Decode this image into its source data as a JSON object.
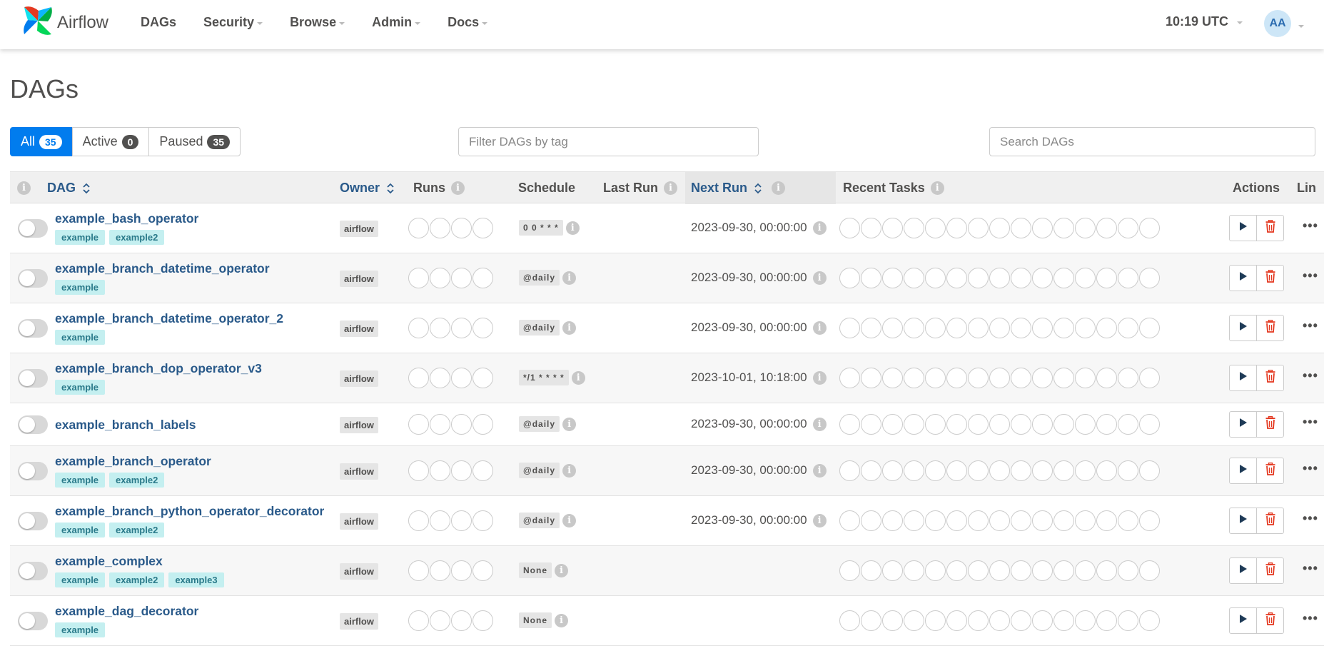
{
  "nav": {
    "brand": "Airflow",
    "items": [
      "DAGs",
      "Security",
      "Browse",
      "Admin",
      "Docs"
    ],
    "clock": "10:19 UTC",
    "user_initials": "AA"
  },
  "page": {
    "title": "DAGs"
  },
  "filters": {
    "all_label": "All",
    "all_count": "35",
    "active_label": "Active",
    "active_count": "0",
    "paused_label": "Paused",
    "paused_count": "35",
    "tag_placeholder": "Filter DAGs by tag",
    "search_placeholder": "Search DAGs"
  },
  "table": {
    "headers": {
      "dag": "DAG",
      "owner": "Owner",
      "runs": "Runs",
      "schedule": "Schedule",
      "last_run": "Last Run",
      "next_run": "Next Run",
      "recent_tasks": "Recent Tasks",
      "actions": "Actions",
      "links": "Lin"
    },
    "rows": [
      {
        "name": "example_bash_operator",
        "tags": [
          "example",
          "example2"
        ],
        "owner": "airflow",
        "schedule": "0 0 * * *",
        "next_run": "2023-09-30, 00:00:00",
        "paused": true
      },
      {
        "name": "example_branch_datetime_operator",
        "tags": [
          "example"
        ],
        "owner": "airflow",
        "schedule": "@daily",
        "next_run": "2023-09-30, 00:00:00",
        "paused": true
      },
      {
        "name": "example_branch_datetime_operator_2",
        "tags": [
          "example"
        ],
        "owner": "airflow",
        "schedule": "@daily",
        "next_run": "2023-09-30, 00:00:00",
        "paused": true
      },
      {
        "name": "example_branch_dop_operator_v3",
        "tags": [
          "example"
        ],
        "owner": "airflow",
        "schedule": "*/1 * * * *",
        "next_run": "2023-10-01, 10:18:00",
        "paused": true
      },
      {
        "name": "example_branch_labels",
        "tags": [],
        "owner": "airflow",
        "schedule": "@daily",
        "next_run": "2023-09-30, 00:00:00",
        "paused": true
      },
      {
        "name": "example_branch_operator",
        "tags": [
          "example",
          "example2"
        ],
        "owner": "airflow",
        "schedule": "@daily",
        "next_run": "2023-09-30, 00:00:00",
        "paused": true
      },
      {
        "name": "example_branch_python_operator_decorator",
        "tags": [
          "example",
          "example2"
        ],
        "owner": "airflow",
        "schedule": "@daily",
        "next_run": "2023-09-30, 00:00:00",
        "paused": true
      },
      {
        "name": "example_complex",
        "tags": [
          "example",
          "example2",
          "example3"
        ],
        "owner": "airflow",
        "schedule": "None",
        "next_run": "",
        "paused": true
      },
      {
        "name": "example_dag_decorator",
        "tags": [
          "example"
        ],
        "owner": "airflow",
        "schedule": "None",
        "next_run": "",
        "paused": true
      }
    ],
    "run_state_slots": 4,
    "task_state_slots": 15
  },
  "icons": {
    "brand": "airflow-pinwheel-icon",
    "trigger": "play-icon",
    "delete": "trash-icon",
    "links": "ellipsis-icon",
    "info": "info-icon",
    "sort": "sort-arrows-icon"
  },
  "colors": {
    "accent": "#017cee",
    "link": "#2a5a8a",
    "tag_bg": "#c4eff0",
    "delete": "#e43921"
  }
}
